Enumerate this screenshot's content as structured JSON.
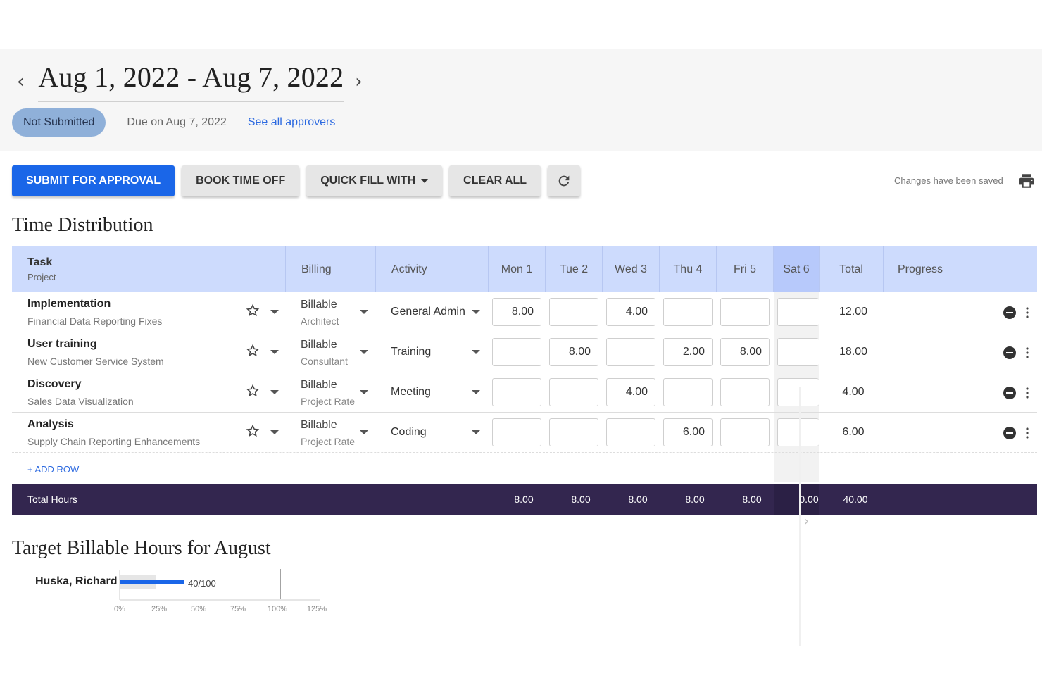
{
  "header": {
    "period_title": "Aug 1, 2022 - Aug 7, 2022",
    "prev_icon": "chevron-left-icon",
    "next_icon": "chevron-right-icon",
    "status": "Not Submitted",
    "due": "Due on Aug 7, 2022",
    "approvers_link": "See all approvers"
  },
  "toolbar": {
    "submit": "SUBMIT FOR APPROVAL",
    "book_time_off": "BOOK TIME OFF",
    "quick_fill": "QUICK FILL WITH",
    "clear_all": "CLEAR ALL",
    "refresh_icon": "refresh-icon",
    "saved_status": "Changes have been saved",
    "print_icon": "print-icon"
  },
  "time_distribution": {
    "title": "Time Distribution",
    "columns": {
      "task": "Task",
      "project": "Project",
      "billing": "Billing",
      "activity": "Activity",
      "days": [
        "Mon 1",
        "Tue 2",
        "Wed 3",
        "Thu 4",
        "Fri 5",
        "Sat 6"
      ],
      "total": "Total",
      "progress": "Progress"
    },
    "rows": [
      {
        "task": "Implementation",
        "project": "Financial Data Reporting Fixes",
        "billing": "Billable",
        "role": "Architect",
        "activity": "General Admin",
        "hours": [
          "8.00",
          "",
          "4.00",
          "",
          "",
          ""
        ],
        "total": "12.00"
      },
      {
        "task": "User training",
        "project": "New Customer Service System",
        "billing": "Billable",
        "role": "Consultant",
        "activity": "Training",
        "hours": [
          "",
          "8.00",
          "",
          "2.00",
          "8.00",
          ""
        ],
        "total": "18.00"
      },
      {
        "task": "Discovery",
        "project": "Sales Data Visualization",
        "billing": "Billable",
        "role": "Project Rate",
        "activity": "Meeting",
        "hours": [
          "",
          "",
          "4.00",
          "",
          "",
          ""
        ],
        "total": "4.00"
      },
      {
        "task": "Analysis",
        "project": "Supply Chain Reporting Enhancements",
        "billing": "Billable",
        "role": "Project Rate",
        "activity": "Coding",
        "hours": [
          "",
          "",
          "",
          "6.00",
          "",
          ""
        ],
        "total": "6.00"
      }
    ],
    "add_row": "+ ADD ROW",
    "footer": {
      "label": "Total Hours",
      "days": [
        "8.00",
        "8.00",
        "8.00",
        "8.00",
        "8.00",
        "0.00"
      ],
      "total": "40.00"
    }
  },
  "target": {
    "title": "Target Billable Hours for August",
    "person": "Huska, Richard",
    "value_label": "40/100",
    "progress_fraction": 0.4,
    "ticks": [
      "0%",
      "25%",
      "50%",
      "75%",
      "100%",
      "125%"
    ],
    "bar_color": "#1a66e8"
  }
}
